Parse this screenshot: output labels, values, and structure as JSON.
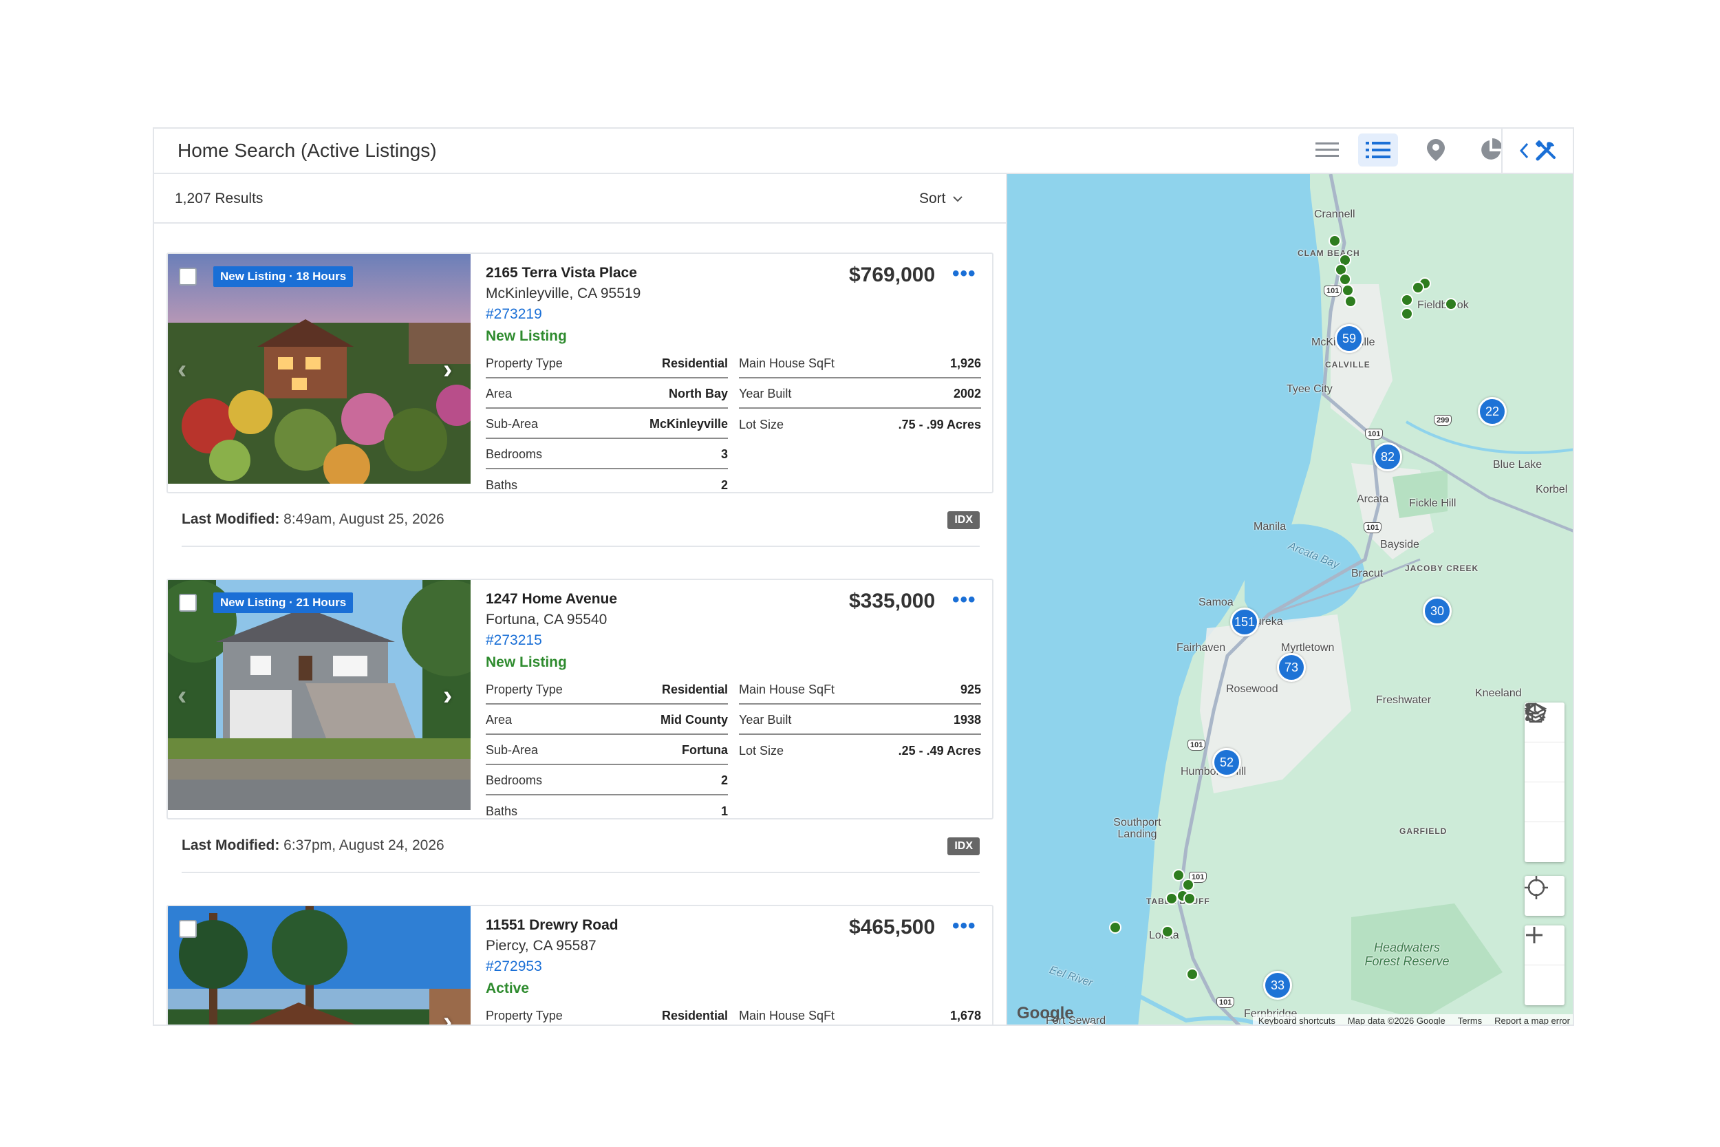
{
  "header": {
    "title": "Home Search (Active Listings)",
    "views": [
      "list-view-icon",
      "detailed-list-view-icon",
      "map-pin-icon",
      "pie-chart-icon"
    ],
    "active_view": "detailed-list-view-icon"
  },
  "results": {
    "count": "1,207 Results",
    "sort_label": "Sort"
  },
  "listings": [
    {
      "badge": "New Listing · 18 Hours",
      "address1": "2165 Terra Vista Place",
      "address2": "McKinleyville, CA 95519",
      "mls": "#273219",
      "status": "New Listing",
      "price": "$769,000",
      "left_specs": [
        {
          "k": "Property Type",
          "v": "Residential"
        },
        {
          "k": "Area",
          "v": "North Bay"
        },
        {
          "k": "Sub-Area",
          "v": "McKinleyville"
        },
        {
          "k": "Bedrooms",
          "v": "3"
        },
        {
          "k": "Baths",
          "v": "2"
        }
      ],
      "right_specs": [
        {
          "k": "Main House SqFt",
          "v": "1,926"
        },
        {
          "k": "Year Built",
          "v": "2002"
        },
        {
          "k": "Lot Size",
          "v": ".75 - .99 Acres"
        }
      ],
      "last_modified_label": "Last Modified:",
      "last_modified": "8:49am, August 25, 2026",
      "idx": "IDX"
    },
    {
      "badge": "New Listing · 21 Hours",
      "address1": "1247 Home Avenue",
      "address2": "Fortuna, CA 95540",
      "mls": "#273215",
      "status": "New Listing",
      "price": "$335,000",
      "left_specs": [
        {
          "k": "Property Type",
          "v": "Residential"
        },
        {
          "k": "Area",
          "v": "Mid County"
        },
        {
          "k": "Sub-Area",
          "v": "Fortuna"
        },
        {
          "k": "Bedrooms",
          "v": "2"
        },
        {
          "k": "Baths",
          "v": "1"
        }
      ],
      "right_specs": [
        {
          "k": "Main House SqFt",
          "v": "925"
        },
        {
          "k": "Year Built",
          "v": "1938"
        },
        {
          "k": "Lot Size",
          "v": ".25 - .49 Acres"
        }
      ],
      "last_modified_label": "Last Modified:",
      "last_modified": "6:37pm, August 24, 2026",
      "idx": "IDX"
    },
    {
      "badge": "",
      "address1": "11551 Drewry Road",
      "address2": "Piercy, CA 95587",
      "mls": "#272953",
      "status": "Active",
      "price": "$465,500",
      "left_specs": [
        {
          "k": "Property Type",
          "v": "Residential"
        }
      ],
      "right_specs": [
        {
          "k": "Main House SqFt",
          "v": "1,678"
        }
      ]
    }
  ],
  "map": {
    "places": [
      "Crannell",
      "CLAM BEACH",
      "Fieldbrook",
      "McKinleyville",
      "CALVILLE",
      "Tyee City",
      "Blue Lake",
      "Korbel",
      "Arcata",
      "Fickle Hill",
      "Manila",
      "Arcata Bay",
      "Bayside",
      "Bracut",
      "JACOBY CREEK",
      "Samoa",
      "Eureka",
      "Fairhaven",
      "Myrtletown",
      "Rosewood",
      "Freshwater",
      "Kneeland",
      "Humboldt Hill",
      "Southport Landing",
      "GARFIELD",
      "TABLE BLUFF",
      "Loleta",
      "Headwaters Forest Reserve",
      "Eel River",
      "Fort Seward",
      "Fernbridge"
    ],
    "clusters": [
      "59",
      "22",
      "82",
      "30",
      "151",
      "73",
      "52",
      "33"
    ],
    "google": "Google",
    "attribution": [
      "Keyboard shortcuts",
      "Map data ©2026 Google",
      "Terms",
      "Report a map error"
    ]
  },
  "colors": {
    "accent": "#1a6fd6",
    "status_green": "#2e8b2e",
    "cluster": "#1e73d6",
    "pin": "#2e7d1f",
    "water": "#8fd3ec",
    "land": "#cdebd8"
  }
}
